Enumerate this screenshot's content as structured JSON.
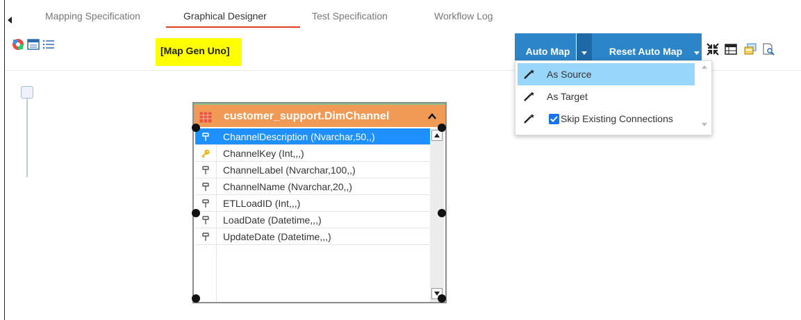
{
  "tabs": [
    {
      "label": "Mapping Specification",
      "active": false
    },
    {
      "label": "Graphical Designer",
      "active": true
    },
    {
      "label": "Test Specification",
      "active": false
    },
    {
      "label": "Workflow Log",
      "active": false
    }
  ],
  "toolbar": {
    "left_icons": [
      "palette-icon",
      "window-icon",
      "list-icon"
    ],
    "diagram_label": "[Map Gen Uno]",
    "auto_map_label": "Auto Map",
    "reset_auto_map_label": "Reset Auto Map",
    "right_icons": [
      "fit-to-screen-icon",
      "layout-icon",
      "export-image-icon",
      "print-preview-icon"
    ]
  },
  "auto_map_menu": {
    "items": [
      {
        "label": "As Source",
        "selected": true,
        "icon": "magic-wand-icon"
      },
      {
        "label": "As Target",
        "selected": false,
        "icon": "magic-wand-icon"
      },
      {
        "label": "Skip Existing Connections",
        "selected": false,
        "icon": "magic-wand-icon",
        "checked": true
      }
    ]
  },
  "entity": {
    "title": "customer_support.DimChannel",
    "columns": [
      {
        "label": "ChannelDescription (Nvarchar,50,,)",
        "icon": "column-icon",
        "selected": true
      },
      {
        "label": "ChannelKey (Int,,,)",
        "icon": "primary-key-icon",
        "selected": false
      },
      {
        "label": "ChannelLabel (Nvarchar,100,,)",
        "icon": "column-icon",
        "selected": false
      },
      {
        "label": "ChannelName (Nvarchar,20,,)",
        "icon": "column-icon",
        "selected": false
      },
      {
        "label": "ETLLoadID (Int,,,)",
        "icon": "column-icon",
        "selected": false
      },
      {
        "label": "LoadDate (Datetime,,,)",
        "icon": "column-icon",
        "selected": false
      },
      {
        "label": "UpdateDate (Datetime,,,)",
        "icon": "column-icon",
        "selected": false
      }
    ]
  },
  "colors": {
    "tab_underline": "#e0401f",
    "button_blue": "#2b85c8",
    "entity_header": "#f19a56",
    "selected_row": "#1e90ff",
    "menu_selected": "#99d6fb",
    "label_highlight": "#ffff00"
  }
}
